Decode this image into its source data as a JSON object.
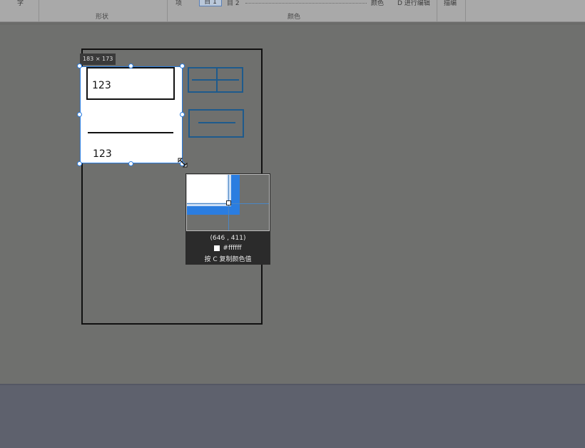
{
  "ribbon": {
    "left_char": "字",
    "item1": "项",
    "tab_selected": "目 1",
    "tab2": "目 2",
    "color_btn": "颜色",
    "edit_btn": "D 进行编辑",
    "extra_btn": "描编",
    "group_shape": "形状",
    "group_color": "颜色"
  },
  "canvas": {
    "size_tag": "183 × 173",
    "cell_top": "123",
    "cell_bottom": "123"
  },
  "magnifier": {
    "coords": "(646 , 411)",
    "hex": "#ffffff",
    "hint": "按 C 复制颜色值"
  },
  "colors": {
    "selection_blue": "#2b7de0",
    "icon_blue": "#1e5a8c",
    "background_gray": "#6f706e"
  }
}
